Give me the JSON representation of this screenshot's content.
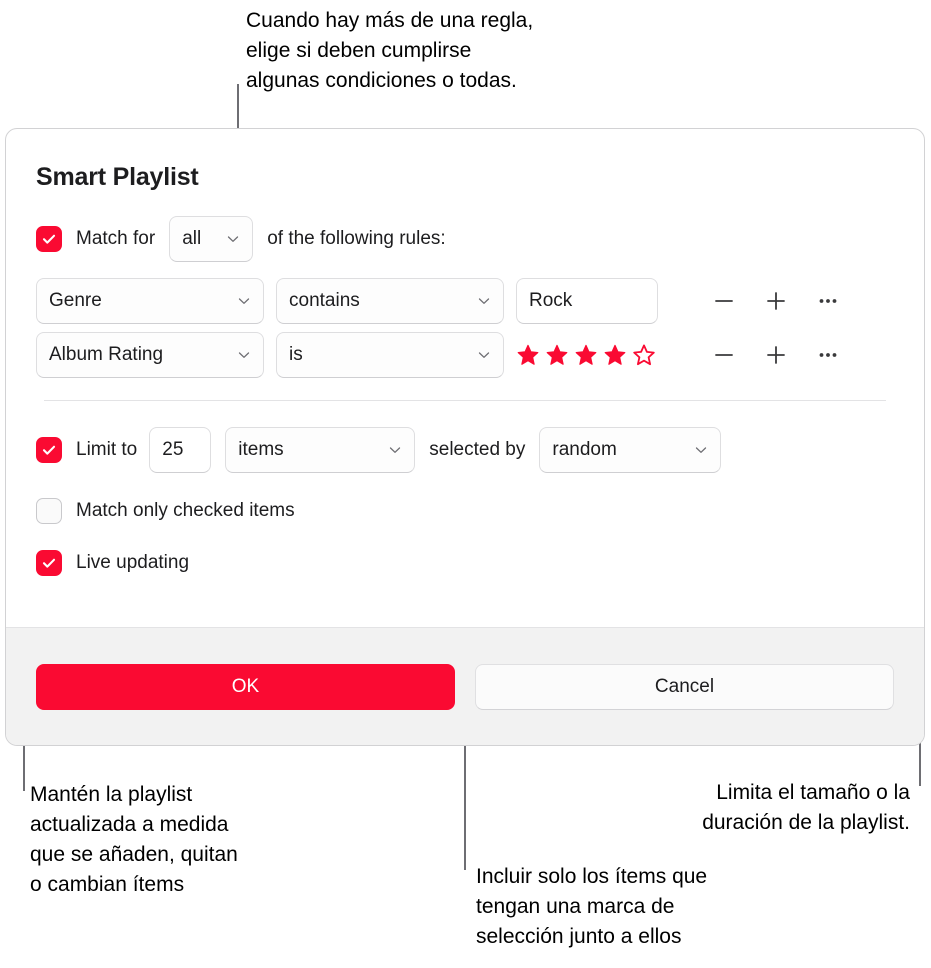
{
  "annotations": {
    "top": "Cuando hay más de una regla,\nelige si deben cumplirse\nalgunas condiciones o todas.",
    "live_updating": "Mantén la playlist\nactualizada a medida\nque se añaden, quitan\no cambian ítems",
    "checked_items": "Incluir solo los ítems que\ntengan una marca de\nselección junto a ellos",
    "limit": "Limita el tamaño o la\nduración de la playlist."
  },
  "dialog": {
    "title": "Smart Playlist",
    "match": {
      "checked": true,
      "label": "Match  for",
      "operator": "all",
      "suffix": "of the following rules:"
    },
    "rules": [
      {
        "field": "Genre",
        "operator": "contains",
        "value_type": "text",
        "value": "Rock",
        "remove_label": "−",
        "add_label": "+",
        "more_label": "•••"
      },
      {
        "field": "Album Rating",
        "operator": "is",
        "value_type": "stars",
        "stars_filled": 4,
        "stars_total": 5,
        "remove_label": "−",
        "add_label": "+",
        "more_label": "•••"
      }
    ],
    "limit": {
      "checked": true,
      "label": "Limit to",
      "amount": "25",
      "unit": "items",
      "selected_by_label": "selected by",
      "selected_by": "random"
    },
    "match_only_checked": {
      "checked": false,
      "label": "Match only checked items"
    },
    "live_updating": {
      "checked": true,
      "label": "Live updating"
    },
    "footer": {
      "ok": "OK",
      "cancel": "Cancel"
    }
  },
  "colors": {
    "accent_red": "#fa0a32",
    "leader_line": "#6e6e73",
    "footer_bg": "#f2f2f2"
  }
}
